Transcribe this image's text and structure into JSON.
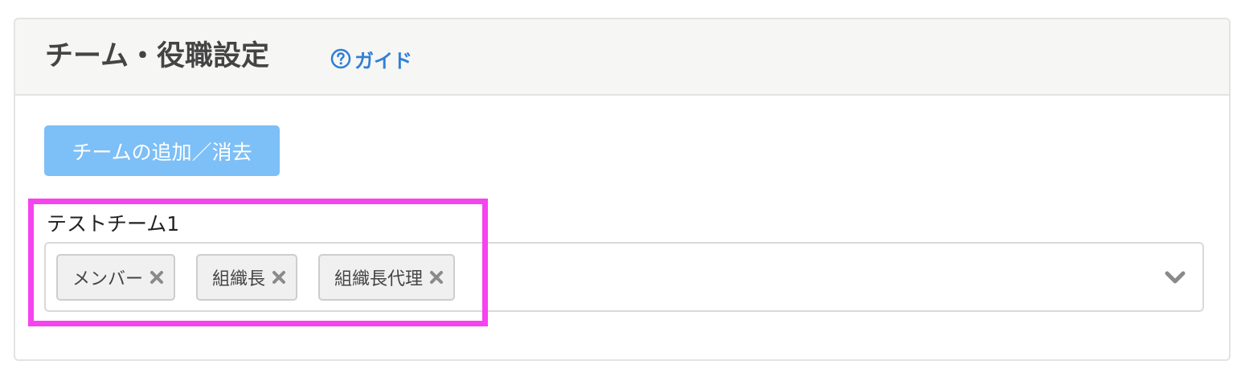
{
  "header": {
    "title": "チーム・役職設定",
    "guide_label": "ガイド",
    "guide_icon": "question-circle-icon",
    "accent_color": "#2f7fd6"
  },
  "toolbar": {
    "add_remove_team_label": "チームの追加／消去"
  },
  "team": {
    "name": "テストチーム1",
    "roles": [
      {
        "label": "メンバー",
        "remove_icon": "close-icon"
      },
      {
        "label": "組織長",
        "remove_icon": "close-icon"
      },
      {
        "label": "組織長代理",
        "remove_icon": "close-icon"
      }
    ],
    "dropdown_icon": "chevron-down-icon"
  },
  "highlight_color": "#f543f0"
}
